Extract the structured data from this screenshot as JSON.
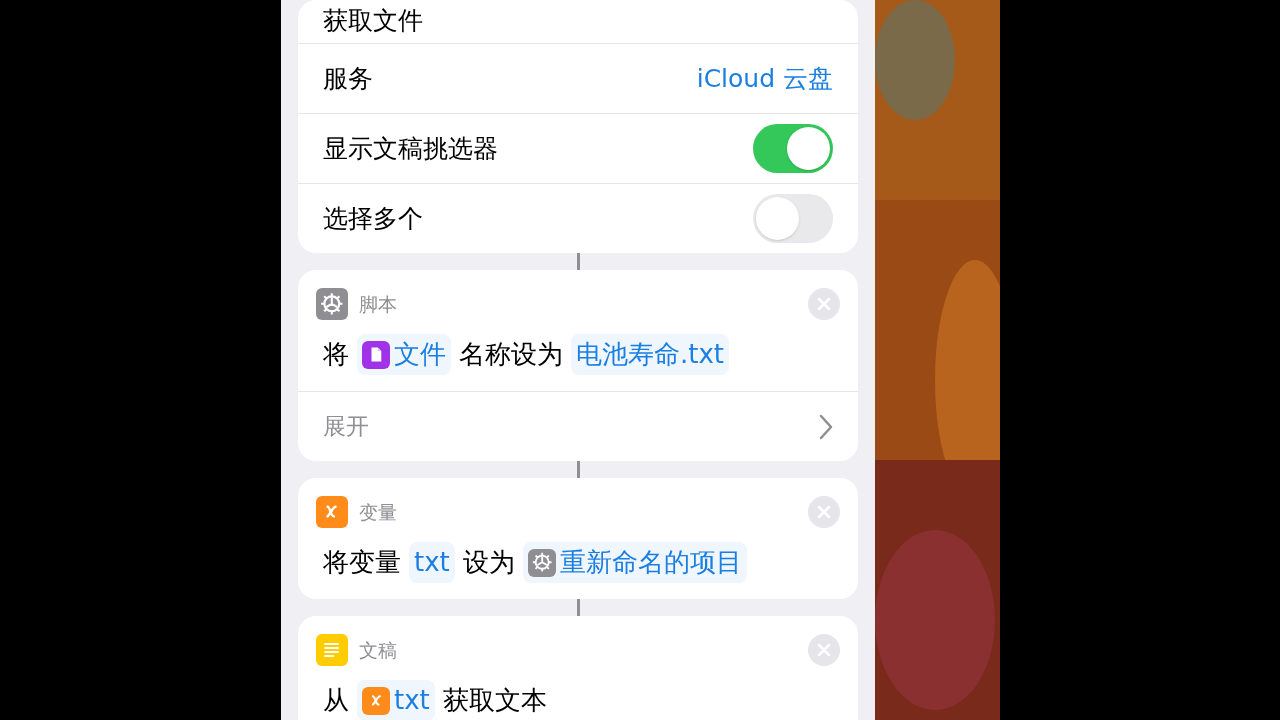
{
  "cards": [
    {
      "kind": "settings",
      "rows": [
        {
          "kind": "title",
          "label": "获取文件"
        },
        {
          "kind": "value",
          "label": "服务",
          "value": "iCloud 云盘"
        },
        {
          "kind": "toggle",
          "label": "显示文稿挑选器",
          "on": true
        },
        {
          "kind": "toggle",
          "label": "选择多个",
          "on": false
        }
      ]
    },
    {
      "kind": "script",
      "app": "脚本",
      "color": "#8e8e93",
      "parts": [
        {
          "kind": "text",
          "text": "将"
        },
        {
          "kind": "file_token",
          "text": "文件"
        },
        {
          "kind": "text",
          "text": "名称设为"
        },
        {
          "kind": "token",
          "text": "电池寿命.txt"
        }
      ],
      "footer": "展开"
    },
    {
      "kind": "variable",
      "app": "变量",
      "color": "#ff8c1a",
      "parts": [
        {
          "kind": "text",
          "text": "将变量"
        },
        {
          "kind": "token",
          "text": "txt"
        },
        {
          "kind": "text",
          "text": "设为"
        },
        {
          "kind": "gear_token",
          "text": "重新命名的项目"
        }
      ]
    },
    {
      "kind": "document",
      "app": "文稿",
      "color": "#ffcc00",
      "parts": [
        {
          "kind": "text",
          "text": "从"
        },
        {
          "kind": "variable_token",
          "text": "txt"
        },
        {
          "kind": "text",
          "text": "获取文本"
        }
      ]
    }
  ]
}
